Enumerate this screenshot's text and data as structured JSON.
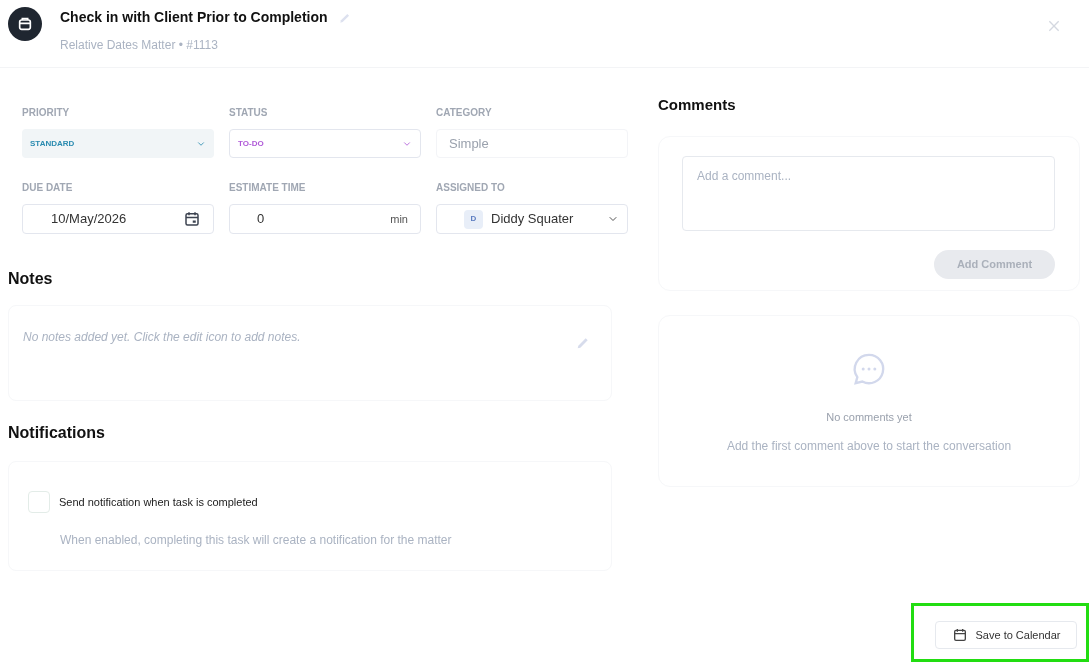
{
  "header": {
    "title": "Check in with Client Prior to Completion",
    "subtitle": "Relative Dates Matter • #1113"
  },
  "fields": [
    {
      "kind": "select",
      "label": "PRIORITY",
      "value": "STANDARD",
      "color": "#2a8bb0"
    },
    {
      "kind": "select",
      "label": "STATUS",
      "value": "TO-DO",
      "color": "#b05ad8"
    },
    {
      "kind": "readonly",
      "label": "CATEGORY",
      "value": "Simple"
    },
    {
      "kind": "date",
      "label": "DUE DATE",
      "value": "10/May/2026"
    },
    {
      "kind": "number",
      "label": "ESTIMATE TIME",
      "value": "0",
      "unit": "min"
    },
    {
      "kind": "person",
      "label": "ASSIGNED TO",
      "value": "Diddy Squater",
      "initial": "D"
    }
  ],
  "notes": {
    "heading": "Notes",
    "empty_text": "No notes added yet. Click the edit icon to add notes."
  },
  "notifications": {
    "heading": "Notifications",
    "option": {
      "label": "Send notification when task is completed",
      "checked": false
    },
    "hint": "When enabled, completing this task will create a notification for the matter"
  },
  "comments": {
    "heading": "Comments",
    "placeholder": "Add a comment...",
    "button": {
      "label": "Add Comment",
      "disabled": true
    },
    "empty_title": "No comments yet",
    "empty_text": "Add the first comment above to start the conversation"
  },
  "footer": {
    "button": {
      "label": "Save to Calendar",
      "highlighted": true
    }
  }
}
